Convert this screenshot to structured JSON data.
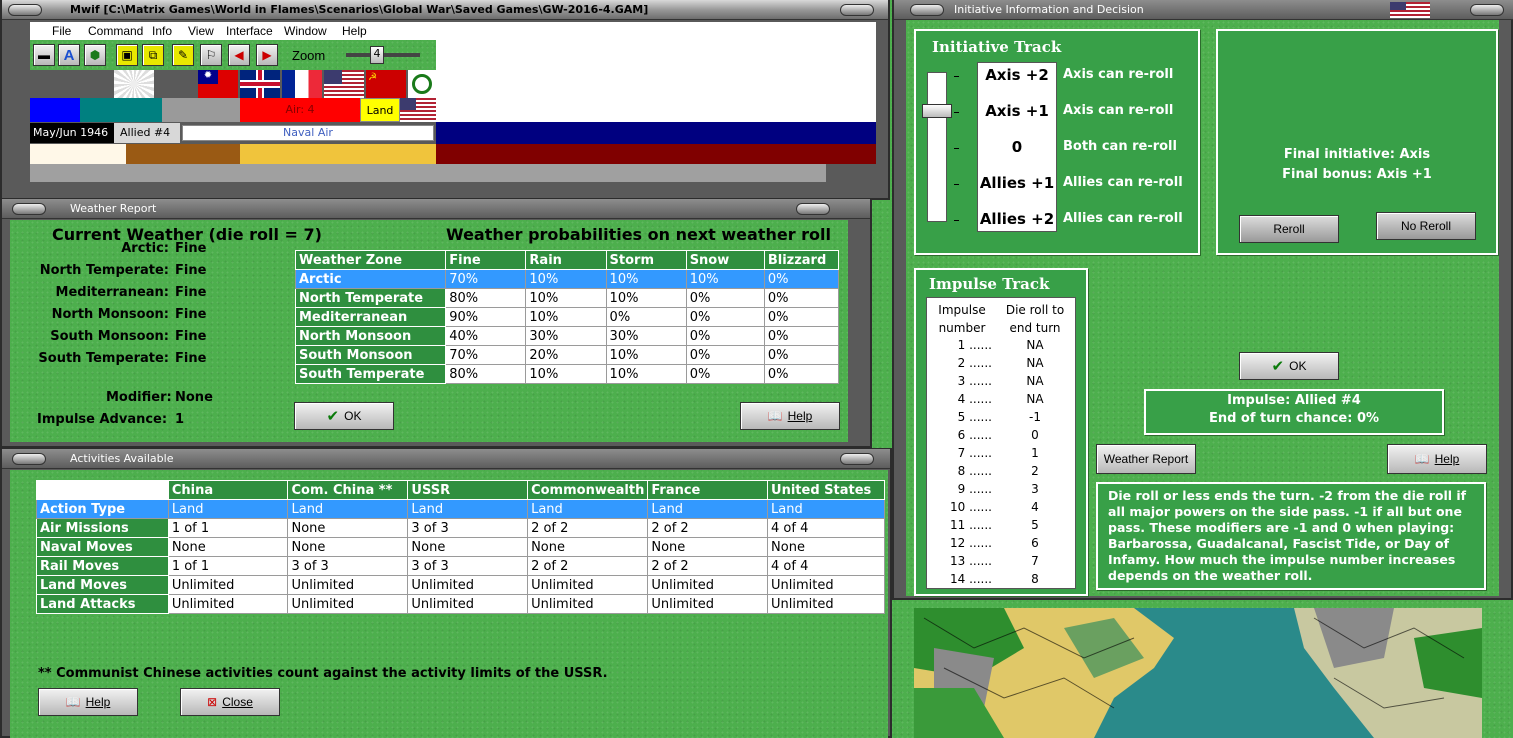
{
  "main_window": {
    "title": "Mwif [C:\\Matrix Games\\World in Flames\\Scenarios\\Global War\\Saved Games\\GW-2016-4.GAM]",
    "menu": [
      "File",
      "Command",
      "Info",
      "View",
      "Interface",
      "Window",
      "Help"
    ],
    "zoom_label": "Zoom",
    "zoom_value": "4",
    "date": "May/Jun 1946",
    "impulse": "Allied #4",
    "air_label": "Air: 4",
    "land_label": "Land",
    "naval_air": "Naval Air"
  },
  "weather": {
    "title": "Weather Report",
    "heading": "Current Weather (die roll = 7)",
    "prob_heading": "Weather probabilities on next weather roll",
    "zones": [
      {
        "name": "Arctic:",
        "value": "Fine"
      },
      {
        "name": "North Temperate:",
        "value": "Fine"
      },
      {
        "name": "Mediterranean:",
        "value": "Fine"
      },
      {
        "name": "North Monsoon:",
        "value": "Fine"
      },
      {
        "name": "South Monsoon:",
        "value": "Fine"
      },
      {
        "name": "South Temperate:",
        "value": "Fine"
      }
    ],
    "modifier_label": "Modifier:",
    "modifier_value": "None",
    "advance_label": "Impulse Advance:",
    "advance_value": "1",
    "columns": [
      "Weather Zone",
      "Fine",
      "Rain",
      "Storm",
      "Snow",
      "Blizzard"
    ],
    "rows": [
      [
        "Arctic",
        "70%",
        "10%",
        "10%",
        "10%",
        "0%"
      ],
      [
        "North Temperate",
        "80%",
        "10%",
        "10%",
        "0%",
        "0%"
      ],
      [
        "Mediterranean",
        "90%",
        "10%",
        "0%",
        "0%",
        "0%"
      ],
      [
        "North Monsoon",
        "40%",
        "30%",
        "30%",
        "0%",
        "0%"
      ],
      [
        "South Monsoon",
        "70%",
        "20%",
        "10%",
        "0%",
        "0%"
      ],
      [
        "South Temperate",
        "80%",
        "10%",
        "10%",
        "0%",
        "0%"
      ]
    ],
    "ok": "OK",
    "help": "Help"
  },
  "activities": {
    "title": "Activities Available",
    "columns": [
      "",
      "China",
      "Com. China **",
      "USSR",
      "Commonwealth",
      "France",
      "United States"
    ],
    "rows": [
      [
        "Action Type",
        "Land",
        "Land",
        "Land",
        "Land",
        "Land",
        "Land"
      ],
      [
        "Air Missions",
        "1 of 1",
        "None",
        "3 of 3",
        "2 of 2",
        "2 of 2",
        "4 of 4"
      ],
      [
        "Naval Moves",
        "None",
        "None",
        "None",
        "None",
        "None",
        "None"
      ],
      [
        "Rail Moves",
        "1 of 1",
        "3 of 3",
        "3 of 3",
        "2 of 2",
        "2 of 2",
        "4 of 4"
      ],
      [
        "Land Moves",
        "Unlimited",
        "Unlimited",
        "Unlimited",
        "Unlimited",
        "Unlimited",
        "Unlimited"
      ],
      [
        "Land Attacks",
        "Unlimited",
        "Unlimited",
        "Unlimited",
        "Unlimited",
        "Unlimited",
        "Unlimited"
      ]
    ],
    "footnote": "** Communist Chinese activities count against the activity limits of the USSR.",
    "help": "Help",
    "close": "Close"
  },
  "initiative": {
    "title": "Initiative Information and Decision",
    "track_title": "Initiative Track",
    "track": [
      {
        "value": "Axis +2",
        "text": "Axis can re-roll"
      },
      {
        "value": "Axis +1",
        "text": "Axis can re-roll"
      },
      {
        "value": "0",
        "text": "Both can re-roll"
      },
      {
        "value": "Allies +1",
        "text": "Allies can re-roll"
      },
      {
        "value": "Allies +2",
        "text": "Allies can re-roll"
      }
    ],
    "final_initiative": "Final initiative: Axis",
    "final_bonus": "Final bonus: Axis +1",
    "reroll": "Reroll",
    "no_reroll": "No Reroll",
    "impulse_title": "Impulse Track",
    "impulse_col1": [
      "Impulse",
      "number"
    ],
    "impulse_col2": [
      "Die roll to",
      "end turn"
    ],
    "impulse_rows": [
      [
        "1 ......",
        "NA"
      ],
      [
        "2 ......",
        "NA"
      ],
      [
        "3 ......",
        "NA"
      ],
      [
        "4 ......",
        "NA"
      ],
      [
        "5 ......",
        "-1"
      ],
      [
        "6 ......",
        "0"
      ],
      [
        "7 ......",
        "1"
      ],
      [
        "8 ......",
        "2"
      ],
      [
        "9 ......",
        "3"
      ],
      [
        "10 ......",
        "4"
      ],
      [
        "11 ......",
        "5"
      ],
      [
        "12 ......",
        "6"
      ],
      [
        "13 ......",
        "7"
      ],
      [
        "14 ......",
        "8"
      ]
    ],
    "ok": "OK",
    "impulse_status": "Impulse: Allied #4",
    "end_chance": "End of turn chance: 0%",
    "weather_report": "Weather Report",
    "help": "Help",
    "note": "Die roll or less ends the turn.  -2 from the die roll if all major powers on the side pass.  -1 if all but one pass.  These modifiers are -1 and 0 when playing: Barbarossa, Guadalcanal, Fascist Tide, or Day of Infamy.  How much the impulse number increases depends on the weather roll."
  },
  "colors": {
    "felt": "#4daf4d",
    "header": "#2f8f3f",
    "select": "#3399ff",
    "ussr_red": "#cc0000",
    "navy": "#000080",
    "maroon": "#800000"
  }
}
